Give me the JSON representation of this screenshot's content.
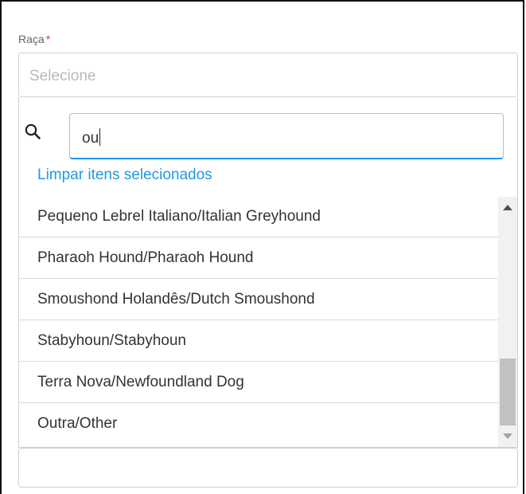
{
  "field": {
    "label": "Raça",
    "required_mark": "*",
    "placeholder": "Selecione"
  },
  "dropdown": {
    "search_value": "ou",
    "clear_label": "Limpar itens selecionados",
    "items": [
      "Pequeno Lebrel Italiano/Italian Greyhound",
      "Pharaoh Hound/Pharaoh Hound",
      "Smoushond Holandês/Dutch Smoushond",
      "Stabyhoun/Stabyhoun",
      "Terra Nova/Newfoundland Dog",
      "Outra/Other"
    ]
  },
  "colors": {
    "required": "#e53935",
    "link": "#1e9be0",
    "focus": "#2196f3"
  },
  "icons": {
    "search": "search-icon",
    "scroll_up": "triangle-up-icon",
    "scroll_down": "triangle-down-icon"
  }
}
